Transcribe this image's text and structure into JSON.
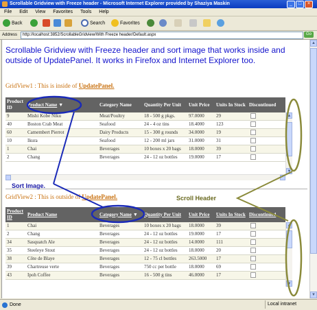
{
  "window": {
    "title": "Scrollable Gridview with Freeze header - Microsoft Internet Explorer provided by Shaziya Maskin",
    "menu": [
      "File",
      "Edit",
      "View",
      "Favorites",
      "Tools",
      "Help"
    ]
  },
  "toolbar": {
    "back_label": "Back",
    "search_label": "Search",
    "favorites_label": "Favorites"
  },
  "address": {
    "label": "Address",
    "url": "http://localhost:3852/ScrollableGridview/With Freeze header/Default.aspx",
    "go_label": "Go"
  },
  "page": {
    "heading": "Scrollable Gridview with Freeze header and sort image that works inside and outside of UpdatePanel. It works in Firefox and Internet Explorer too.",
    "gridview1_title": "GridView1 : This is inside of ",
    "gridview1_title_bold": "UpdatePanel.",
    "gridview2_title": "GridView2 : This is outside of ",
    "gridview2_title_bold": "UpdatePanel."
  },
  "grid1": {
    "headers": [
      "Product ID",
      "Product Name",
      "Category Name",
      "Quantity Per Unit",
      "Unit Price",
      "Units In Stock",
      "Discontinued"
    ],
    "sort_arrow": "▼",
    "rows": [
      [
        "9",
        "Mishi Kobe Niku",
        "Meat/Poultry",
        "18 - 500 g pkgs.",
        "97.0000",
        "29"
      ],
      [
        "40",
        "Boston Crab Meat",
        "Seafood",
        "24 - 4 oz tins",
        "18.4000",
        "123"
      ],
      [
        "60",
        "Camembert Pierrot",
        "Dairy Products",
        "15 - 300 g rounds",
        "34.0000",
        "19"
      ],
      [
        "10",
        "Ikura",
        "Seafood",
        "12 - 200 ml jars",
        "31.0000",
        "31"
      ],
      [
        "1",
        "Chai",
        "Beverages",
        "10 boxes x 20 bags",
        "18.0000",
        "39"
      ],
      [
        "2",
        "Chang",
        "Beverages",
        "24 - 12 oz bottles",
        "19.0000",
        "17"
      ]
    ]
  },
  "grid2": {
    "headers": [
      "Product ID",
      "Product Name",
      "Category Name",
      "Quantity Per Unit",
      "Unit Price",
      "Units In Stock",
      "Discontinued"
    ],
    "sort_arrow": "▼",
    "rows": [
      [
        "1",
        "Chai",
        "Beverages",
        "10 boxes x 20 bags",
        "18.0000",
        "39"
      ],
      [
        "2",
        "Chang",
        "Beverages",
        "24 - 12 oz bottles",
        "19.0000",
        "17"
      ],
      [
        "34",
        "Sasquatch Ale",
        "Beverages",
        "24 - 12 oz bottles",
        "14.0000",
        "111"
      ],
      [
        "35",
        "Steeleye Stout",
        "Beverages",
        "24 - 12 oz bottles",
        "18.0000",
        "20"
      ],
      [
        "38",
        "Côte de Blaye",
        "Beverages",
        "12 - 75 cl bottles",
        "263.5000",
        "17"
      ],
      [
        "39",
        "Chartreuse verte",
        "Beverages",
        "750 cc per bottle",
        "18.0000",
        "69"
      ],
      [
        "43",
        "Ipoh Coffee",
        "Beverages",
        "16 - 500 g tins",
        "46.0000",
        "17"
      ]
    ]
  },
  "annotations": {
    "sort_image": "Sort Image.",
    "scroll_header": "Scroll Header",
    "annotation_color": "#1a1aa6",
    "scroll_color": "#7a7a2a"
  },
  "status": {
    "text": "Done",
    "zone": "Local intranet"
  }
}
